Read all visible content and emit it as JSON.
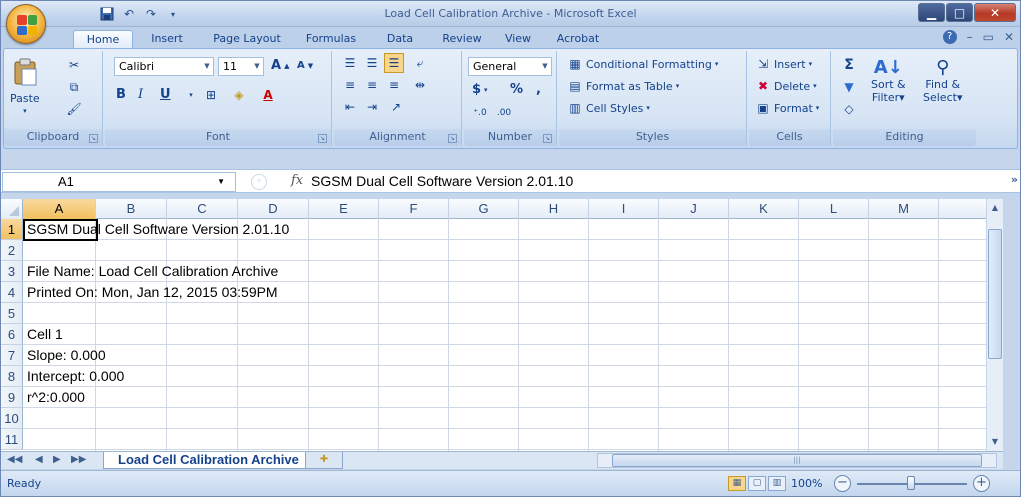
{
  "window": {
    "title": "Load Cell Calibration Archive - Microsoft Excel",
    "controls": {
      "minimize": "▁",
      "maximize": "□",
      "close": "✕"
    }
  },
  "tabs": [
    "Home",
    "Insert",
    "Page Layout",
    "Formulas",
    "Data",
    "Review",
    "View",
    "Acrobat"
  ],
  "active_tab": "Home",
  "ribbon": {
    "clipboard": {
      "label": "Clipboard",
      "paste": "Paste"
    },
    "font": {
      "label": "Font",
      "name": "Calibri",
      "size": "11",
      "grow": "A",
      "shrink": "A",
      "bold": "B",
      "italic": "I",
      "underline": "U"
    },
    "alignment": {
      "label": "Alignment"
    },
    "number": {
      "label": "Number",
      "format": "General",
      "currency": "$",
      "percent": "%",
      "comma": ","
    },
    "styles": {
      "label": "Styles",
      "conditional": "Conditional Formatting",
      "table": "Format as Table",
      "cell_styles": "Cell Styles"
    },
    "cells": {
      "label": "Cells",
      "insert": "Insert",
      "delete": "Delete",
      "format": "Format"
    },
    "editing": {
      "label": "Editing",
      "sort": "Sort &",
      "filter": "Filter",
      "find": "Find &",
      "select": "Select"
    }
  },
  "formula_bar": {
    "name_box": "A1",
    "fx": "fx",
    "content": "SGSM Dual Cell Software Version 2.01.10"
  },
  "columns": [
    "A",
    "B",
    "C",
    "D",
    "E",
    "F",
    "G",
    "H",
    "I",
    "J",
    "K",
    "L",
    "M"
  ],
  "rows": [
    {
      "num": "1",
      "a": "SGSM Dual Cell Software Version 2.01.10"
    },
    {
      "num": "2",
      "a": ""
    },
    {
      "num": "3",
      "a": "File Name: Load Cell Calibration Archive"
    },
    {
      "num": "4",
      "a": "Printed On: Mon, Jan 12, 2015 03:59PM"
    },
    {
      "num": "5",
      "a": ""
    },
    {
      "num": "6",
      "a": "Cell 1"
    },
    {
      "num": "7",
      "a": "Slope: 0.000"
    },
    {
      "num": "8",
      "a": "Intercept: 0.000"
    },
    {
      "num": "9",
      "a": "r^2:0.000"
    },
    {
      "num": "10",
      "a": ""
    },
    {
      "num": "11",
      "a": ""
    }
  ],
  "sheet_tab": "Load Cell Calibration Archive",
  "status": {
    "ready": "Ready",
    "zoom": "100%",
    "zoom_out": "−",
    "zoom_in": "+"
  }
}
